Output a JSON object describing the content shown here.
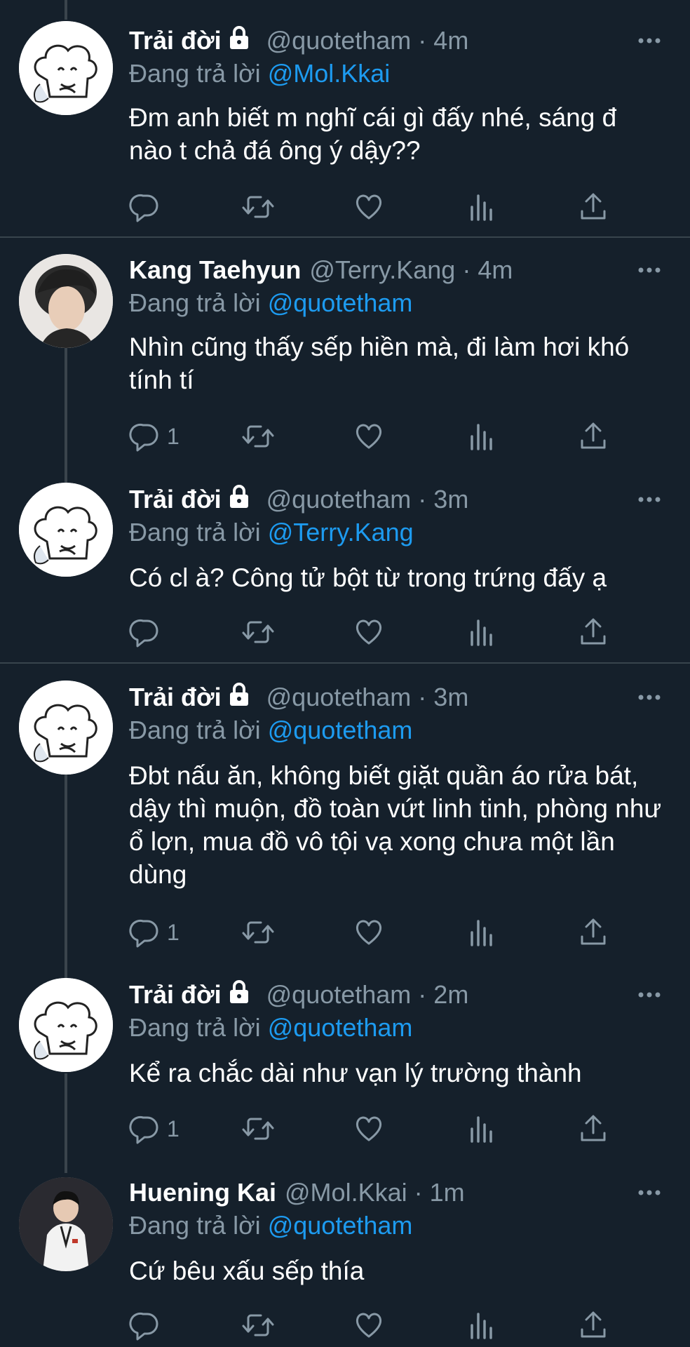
{
  "colors": {
    "background": "#15202b",
    "muted": "#8899a6",
    "accent": "#1d9bf0",
    "divider": "#38444d"
  },
  "icons": {
    "reply": "reply-icon",
    "retweet": "retweet-icon",
    "like": "heart-icon",
    "analytics": "analytics-icon",
    "share": "share-icon",
    "more": "more-icon",
    "lock": "lock-icon"
  },
  "tweets": [
    {
      "name": "Trải đời",
      "handle": "@quotetham",
      "sep": "·",
      "time": "4m",
      "reply_prefix": "Đang trả lời",
      "mention": "@Mol.Kkai",
      "text": "Đm anh biết m nghĩ cái gì đấy nhé, sáng đ nào t chả đá ông ý dậy??",
      "reply_count": ""
    },
    {
      "name": "Kang Taehyun",
      "handle": "@Terry.Kang",
      "sep": "·",
      "time": "4m",
      "reply_prefix": "Đang trả lời",
      "mention": "@quotetham",
      "text": "Nhìn cũng thấy sếp hiền mà, đi làm hơi khó tính tí",
      "reply_count": "1"
    },
    {
      "name": "Trải đời",
      "handle": "@quotetham",
      "sep": "·",
      "time": "3m",
      "reply_prefix": "Đang trả lời",
      "mention": "@Terry.Kang",
      "text": "Có cl à? Công tử bột từ trong trứng đấy ạ",
      "reply_count": ""
    },
    {
      "name": "Trải đời",
      "handle": "@quotetham",
      "sep": "·",
      "time": "3m",
      "reply_prefix": "Đang trả lời",
      "mention": "@quotetham",
      "text": "Đbt nấu ăn, không biết giặt quần áo rửa bát, dậy thì muộn, đồ toàn vứt linh tinh, phòng như ổ lợn, mua đồ vô tội vạ xong chưa một lần dùng",
      "reply_count": "1"
    },
    {
      "name": "Trải đời",
      "handle": "@quotetham",
      "sep": "·",
      "time": "2m",
      "reply_prefix": "Đang trả lời",
      "mention": "@quotetham",
      "text": "Kể ra chắc dài như vạn lý trường thành",
      "reply_count": "1"
    },
    {
      "name": "Huening Kai",
      "handle": "@Mol.Kkai",
      "sep": "·",
      "time": "1m",
      "reply_prefix": "Đang trả lời",
      "mention": "@quotetham",
      "text": "Cứ bêu xấu sếp thía",
      "reply_count": ""
    }
  ]
}
